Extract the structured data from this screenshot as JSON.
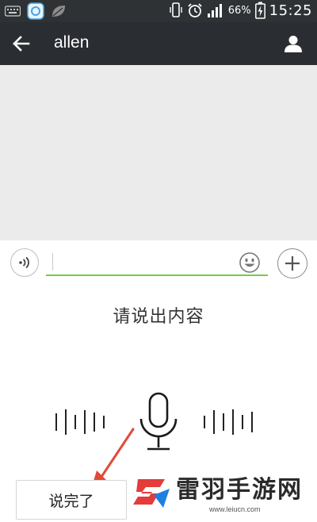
{
  "status_bar": {
    "battery_percent": "66%",
    "time": "15:25",
    "icons": [
      "keyboard-icon",
      "app-icon",
      "leaf-icon",
      "phone-vibrate-icon",
      "alarm-icon",
      "signal-icon",
      "battery-charging-icon"
    ]
  },
  "header": {
    "title": "allen",
    "back_icon": "arrow-left-icon",
    "profile_icon": "person-icon"
  },
  "input_bar": {
    "value": "",
    "voice_icon": "voice-wave-icon",
    "emoji_icon": "smiley-icon",
    "plus_icon": "plus-icon",
    "accent_color": "#6fcf4a"
  },
  "voice_panel": {
    "prompt": "请说出内容",
    "done_label": "说完了",
    "mic_icon": "microphone-icon"
  },
  "watermark": {
    "site_name": "雷羽手游网",
    "url": "www.leiucn.com"
  },
  "colors": {
    "status_bar": "#2e3235",
    "title_bar": "#2a2d31",
    "chat_bg": "#ebebeb",
    "annotation_arrow": "#e14a3a"
  }
}
